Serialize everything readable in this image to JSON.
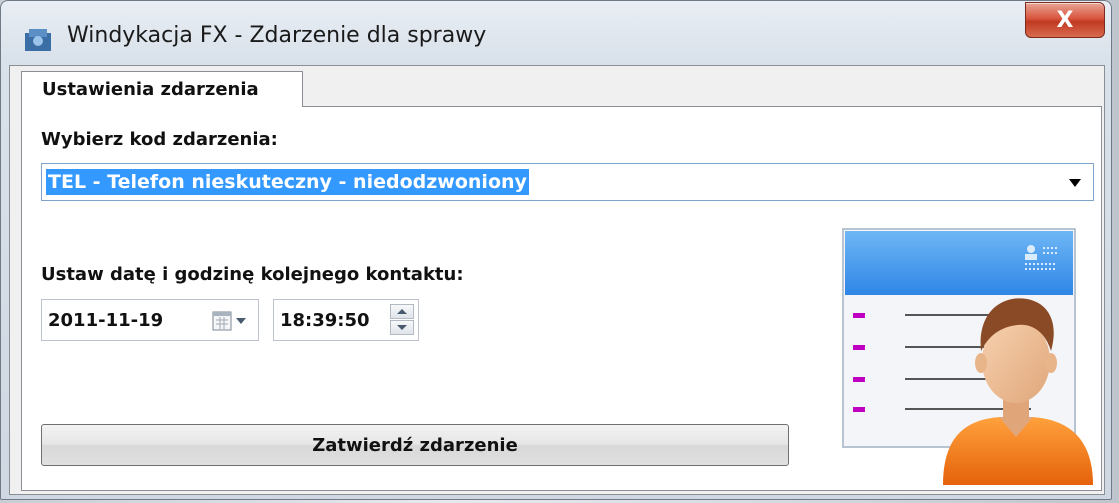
{
  "window": {
    "title": "Windykacja FX - Zdarzenie dla sprawy",
    "close_label": "X"
  },
  "tabs": [
    {
      "label": "Ustawienia zdarzenia",
      "active": true
    }
  ],
  "event_code": {
    "label": "Wybierz kod zdarzenia:",
    "selected_value": "TEL - Telefon nieskuteczny - niedodzwoniony"
  },
  "next_contact": {
    "label": "Ustaw datę i godzinę kolejnego kontaktu:",
    "date": "2011-11-19",
    "time": "18:39:50"
  },
  "submit_button": {
    "label": "Zatwierdź zdarzenie"
  },
  "colors": {
    "selection_highlight": "#3399ff",
    "close_button": "#c03a22",
    "card_header": "#2f86e6",
    "bullet_magenta": "#c000c0",
    "person_shirt": "#f07a10"
  },
  "icons": {
    "app": "app-icon",
    "calendar": "calendar-icon",
    "dropdown": "chevron-down-icon",
    "illustration": "contact-card-person-icon"
  }
}
